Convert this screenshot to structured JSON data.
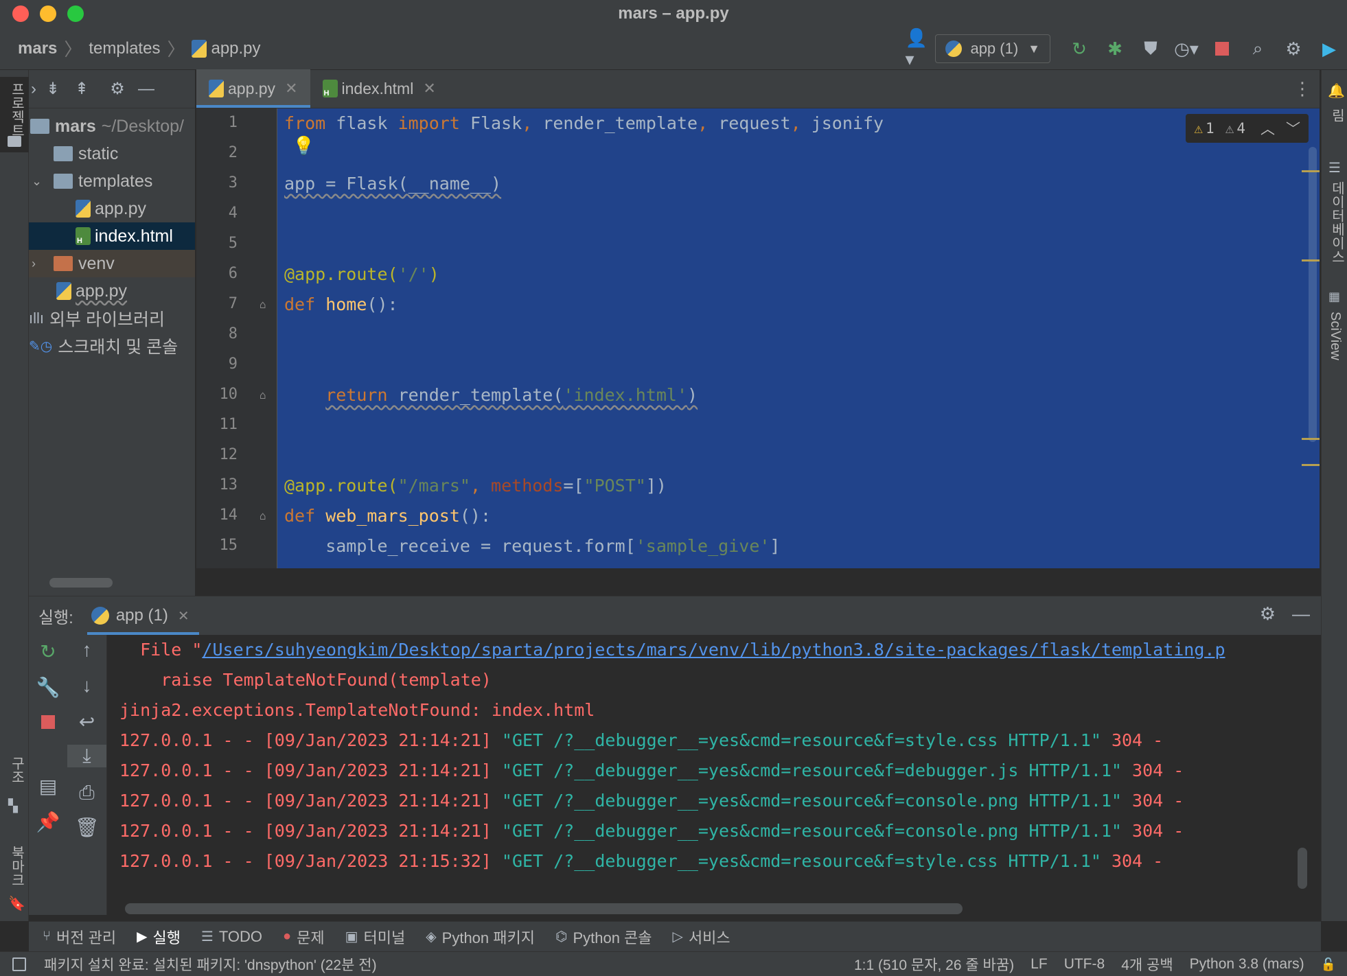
{
  "window": {
    "title": "mars – app.py"
  },
  "breadcrumb": [
    "mars",
    "templates",
    "app.py"
  ],
  "run_config": {
    "label": "app (1)"
  },
  "left_strip": {
    "project_label": "프로젝트",
    "structure_label": "구조",
    "bookmarks_label": "북마크"
  },
  "right_strip": {
    "notifications_label": "알림",
    "database_label": "데이터베이스",
    "sciview_label": "SciView"
  },
  "project_tree": {
    "root_name": "mars",
    "root_path": "~/Desktop/",
    "items": [
      {
        "name": "static"
      },
      {
        "name": "templates"
      },
      {
        "name": "app.py"
      },
      {
        "name": "index.html"
      },
      {
        "name": "venv"
      },
      {
        "name": "app.py"
      },
      {
        "name": "외부 라이브러리"
      },
      {
        "name": "스크래치 및 콘솔"
      }
    ]
  },
  "editor": {
    "tabs": [
      {
        "label": "app.py"
      },
      {
        "label": "index.html"
      }
    ],
    "inspection": {
      "errors": "1",
      "warnings": "4"
    },
    "line_numbers": [
      "1",
      "2",
      "3",
      "4",
      "5",
      "6",
      "7",
      "8",
      "9",
      "10",
      "11",
      "12",
      "13",
      "14",
      "15"
    ],
    "code": {
      "l1": {
        "kw1": "from",
        "t1": " flask ",
        "kw2": "import",
        "t2": " Flask",
        "c1": ",",
        "t3": " render_template",
        "c2": ",",
        "t4": " request",
        "c3": ",",
        "t5": " jsonify"
      },
      "l3": {
        "t": "app = Flask(__name__)"
      },
      "l6": {
        "deco": "@app.route(",
        "str": "'/'",
        "end": ")"
      },
      "l7": {
        "kw": "def",
        "fn": " home",
        "end": "():"
      },
      "l10": {
        "indent": "    ",
        "kw": "return",
        "t": " render_template(",
        "str": "'index.html'",
        "end": ")"
      },
      "l13": {
        "deco": "@app.route(",
        "str": "\"/mars\"",
        "c": ", ",
        "param": "methods",
        "t": "=[",
        "str2": "\"POST\"",
        "end": "])"
      },
      "l14": {
        "kw": "def",
        "fn": " web_mars_post",
        "end": "():"
      },
      "l15": {
        "t": "    sample_receive = request.form[",
        "str": "'sample_give'",
        "end": "]"
      }
    }
  },
  "run_panel": {
    "label": "실행:",
    "tab_label": "app (1)",
    "console": {
      "file_prefix": "  File \"",
      "file_link": "/Users/suhyeongkim/Desktop/sparta/projects/mars/venv/lib/python3.8/site-packages/flask/templating.p",
      "raise_line": "    raise TemplateNotFound(template)",
      "exception_line": "jinja2.exceptions.TemplateNotFound: index.html",
      "log_lines": [
        {
          "prefix": "127.0.0.1 - - [09/Jan/2023 21:14:21] ",
          "request": "\"GET /?__debugger__=yes&cmd=resource&f=style.css HTTP/1.1\"",
          "suffix": " 304 -"
        },
        {
          "prefix": "127.0.0.1 - - [09/Jan/2023 21:14:21] ",
          "request": "\"GET /?__debugger__=yes&cmd=resource&f=debugger.js HTTP/1.1\"",
          "suffix": " 304 -"
        },
        {
          "prefix": "127.0.0.1 - - [09/Jan/2023 21:14:21] ",
          "request": "\"GET /?__debugger__=yes&cmd=resource&f=console.png HTTP/1.1\"",
          "suffix": " 304 -"
        },
        {
          "prefix": "127.0.0.1 - - [09/Jan/2023 21:14:21] ",
          "request": "\"GET /?__debugger__=yes&cmd=resource&f=console.png HTTP/1.1\"",
          "suffix": " 304 -"
        },
        {
          "prefix": "127.0.0.1 - - [09/Jan/2023 21:15:32] ",
          "request": "\"GET /?__debugger__=yes&cmd=resource&f=style.css HTTP/1.1\"",
          "suffix": " 304 -"
        }
      ]
    }
  },
  "tool_tabs": [
    {
      "label": "버전 관리",
      "icon": "branch-icon"
    },
    {
      "label": "실행",
      "icon": "run-icon"
    },
    {
      "label": "TODO",
      "icon": "list-icon"
    },
    {
      "label": "문제",
      "icon": "problem-icon"
    },
    {
      "label": "터미널",
      "icon": "terminal-icon"
    },
    {
      "label": "Python 패키지",
      "icon": "layers-icon"
    },
    {
      "label": "Python 콘솔",
      "icon": "python-icon"
    },
    {
      "label": "서비스",
      "icon": "services-icon"
    }
  ],
  "status_bar": {
    "message": "패키지 설치 완료: 설치된 패키지: 'dnspython' (22분 전)",
    "position": "1:1 (510 문자, 26 줄 바꿈)",
    "line_ending": "LF",
    "encoding": "UTF-8",
    "indent": "4개 공백",
    "interpreter": "Python 3.8 (mars)"
  },
  "colors": {
    "selection": "#21438a",
    "accent": "#4a88c7",
    "error_text": "#ff6b68",
    "link": "#5394ec",
    "request_text": "#2fb5a6"
  }
}
